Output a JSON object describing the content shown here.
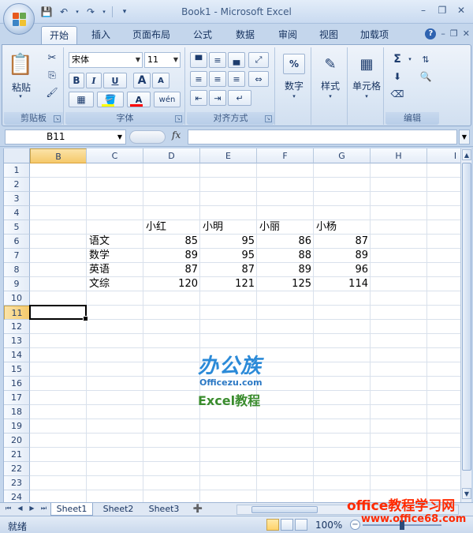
{
  "window": {
    "title": "Book1 - Microsoft Excel"
  },
  "tabs": [
    "开始",
    "插入",
    "页面布局",
    "公式",
    "数据",
    "审阅",
    "视图",
    "加载项"
  ],
  "ribbon": {
    "clipboard": {
      "label": "剪贴板",
      "paste": "粘贴"
    },
    "font": {
      "label": "字体",
      "name": "宋体",
      "size": "11",
      "bold": "B",
      "italic": "I",
      "underline": "U",
      "grow": "A",
      "shrink": "A",
      "color_letter": "A",
      "phonetic": "wén",
      "fill_color": "#ffff00",
      "font_color": "#ff0000"
    },
    "alignment": {
      "label": "对齐方式"
    },
    "number": {
      "label": "数字",
      "symbol": "%"
    },
    "styles": {
      "label": "样式"
    },
    "cells": {
      "label": "单元格"
    },
    "editing": {
      "label": "编辑",
      "sum": "Σ"
    }
  },
  "formula_bar": {
    "name_box": "B11",
    "fx": "fx",
    "formula": ""
  },
  "grid": {
    "columns": [
      "B",
      "C",
      "D",
      "E",
      "F",
      "G",
      "H",
      "I"
    ],
    "rows": [
      "1",
      "2",
      "3",
      "4",
      "5",
      "6",
      "7",
      "8",
      "9",
      "10",
      "11",
      "12",
      "13",
      "14",
      "15",
      "16",
      "17",
      "18",
      "19",
      "20",
      "21",
      "22",
      "23",
      "24"
    ],
    "selected_column": "B",
    "selected_row": "11",
    "headers": [
      "小红",
      "小明",
      "小丽",
      "小杨"
    ],
    "table": [
      {
        "subject": "语文",
        "scores": [
          "85",
          "95",
          "86",
          "87"
        ]
      },
      {
        "subject": "数学",
        "scores": [
          "89",
          "95",
          "88",
          "89"
        ]
      },
      {
        "subject": "英语",
        "scores": [
          "87",
          "87",
          "89",
          "96"
        ]
      },
      {
        "subject": "文综",
        "scores": [
          "120",
          "121",
          "125",
          "114"
        ]
      }
    ]
  },
  "watermark": {
    "title": "办公族",
    "site": "Officezu.com",
    "subtitle": "Excel教程"
  },
  "sheets": [
    "Sheet1",
    "Sheet2",
    "Sheet3"
  ],
  "active_sheet": "Sheet1",
  "status": {
    "text": "就绪",
    "zoom": "100%",
    "zoom_level_percent": 100
  },
  "overlay": {
    "line1": "office教程学习网",
    "line2": "www.office68.com"
  },
  "colors": {
    "accent": "#2f63b0",
    "selected_header": "#f5c96a",
    "watermark_red": "#ff2a00"
  }
}
